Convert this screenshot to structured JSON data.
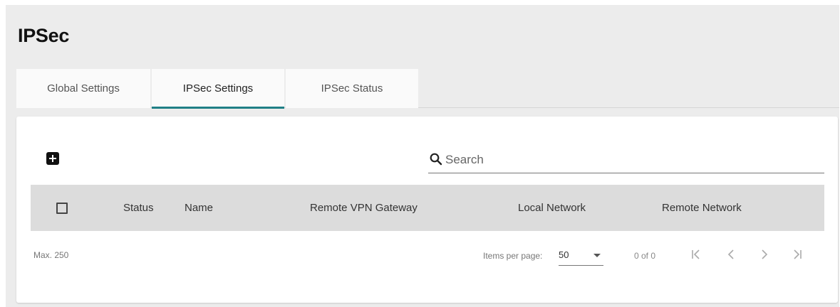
{
  "page": {
    "title": "IPSec"
  },
  "tabs": [
    {
      "label": "Global Settings",
      "active": false
    },
    {
      "label": "IPSec Settings",
      "active": true
    },
    {
      "label": "IPSec Status",
      "active": false
    }
  ],
  "toolbar": {
    "add_icon": "plus-box-icon",
    "search_icon": "search-icon",
    "search_placeholder": "Search"
  },
  "table": {
    "columns": [
      "Status",
      "Name",
      "Remote VPN Gateway",
      "Local Network",
      "Remote Network"
    ],
    "rows": []
  },
  "footer": {
    "max_label": "Max. 250",
    "items_per_page_label": "Items per page:",
    "items_per_page_value": "50",
    "range_label": "0 of 0"
  },
  "colors": {
    "accent": "#1f7f86",
    "page_background": "#ececec",
    "table_header_background": "#dcdcdc"
  }
}
